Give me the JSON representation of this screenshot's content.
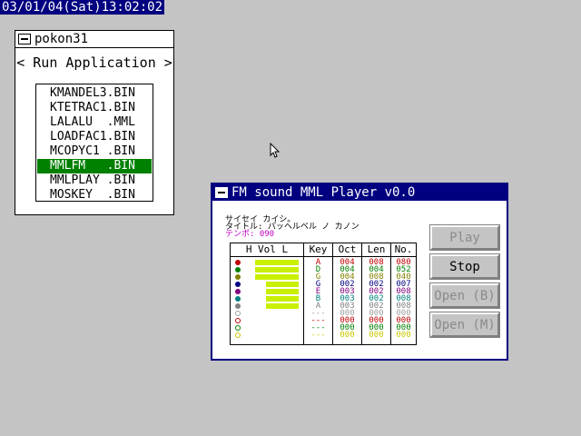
{
  "clock": "03/01/04(Sat)13:02:02",
  "launcher": {
    "title": "pokon31",
    "section": "< Run Application >",
    "files": [
      {
        "name": "KMANDEL3.BIN",
        "selected": false
      },
      {
        "name": "KTETRAC1.BIN",
        "selected": false
      },
      {
        "name": "LALALU  .MML",
        "selected": false
      },
      {
        "name": "LOADFAC1.BIN",
        "selected": false
      },
      {
        "name": "MCOPYC1 .BIN",
        "selected": false
      },
      {
        "name": "MMLFM   .BIN",
        "selected": true
      },
      {
        "name": "MMLPLAY .BIN",
        "selected": false
      },
      {
        "name": "MOSKEY  .BIN",
        "selected": false
      }
    ]
  },
  "player": {
    "title": "FM sound MML Player v0.0",
    "info": [
      "サイセイ カイシ。",
      "タイトル: パッヘルベル ノ カノン",
      "テンポ: 090"
    ],
    "buttons": {
      "play": "Play",
      "stop": "Stop",
      "open_b": "Open (B)",
      "open_m": "Open (M)"
    },
    "headers": {
      "vol": "H  Vol   L",
      "key": "Key",
      "oct": "Oct",
      "len": "Len",
      "no": "No."
    },
    "channels": [
      {
        "color": "#c00000",
        "filled": true,
        "vol": 8,
        "key": "A",
        "oct": "004",
        "len": "008",
        "no": "080"
      },
      {
        "color": "#008000",
        "filled": true,
        "vol": 8,
        "key": "D",
        "oct": "004",
        "len": "004",
        "no": "052"
      },
      {
        "color": "#808000",
        "filled": true,
        "vol": 8,
        "key": "G",
        "oct": "004",
        "len": "008",
        "no": "040"
      },
      {
        "color": "#000080",
        "filled": true,
        "vol": 6,
        "key": "G",
        "oct": "002",
        "len": "002",
        "no": "007"
      },
      {
        "color": "#800080",
        "filled": true,
        "vol": 6,
        "key": "E",
        "oct": "003",
        "len": "002",
        "no": "008"
      },
      {
        "color": "#008080",
        "filled": true,
        "vol": 6,
        "key": "B",
        "oct": "003",
        "len": "002",
        "no": "008"
      },
      {
        "color": "#808080",
        "filled": true,
        "vol": 6,
        "key": "A",
        "oct": "003",
        "len": "002",
        "no": "008"
      },
      {
        "color": "#a0a0a0",
        "filled": false,
        "vol": 0,
        "key": "---",
        "oct": "000",
        "len": "000",
        "no": "000"
      },
      {
        "color": "#c00000",
        "filled": false,
        "vol": 0,
        "key": "---",
        "oct": "000",
        "len": "000",
        "no": "000"
      },
      {
        "color": "#008000",
        "filled": false,
        "vol": 0,
        "key": "---",
        "oct": "000",
        "len": "000",
        "no": "000"
      },
      {
        "color": "#c8c800",
        "filled": false,
        "vol": 0,
        "key": "---",
        "oct": "000",
        "len": "000",
        "no": "000"
      }
    ]
  },
  "colors": {
    "info_line_3": "#c000c0",
    "volume_bar": "#c8f000"
  }
}
